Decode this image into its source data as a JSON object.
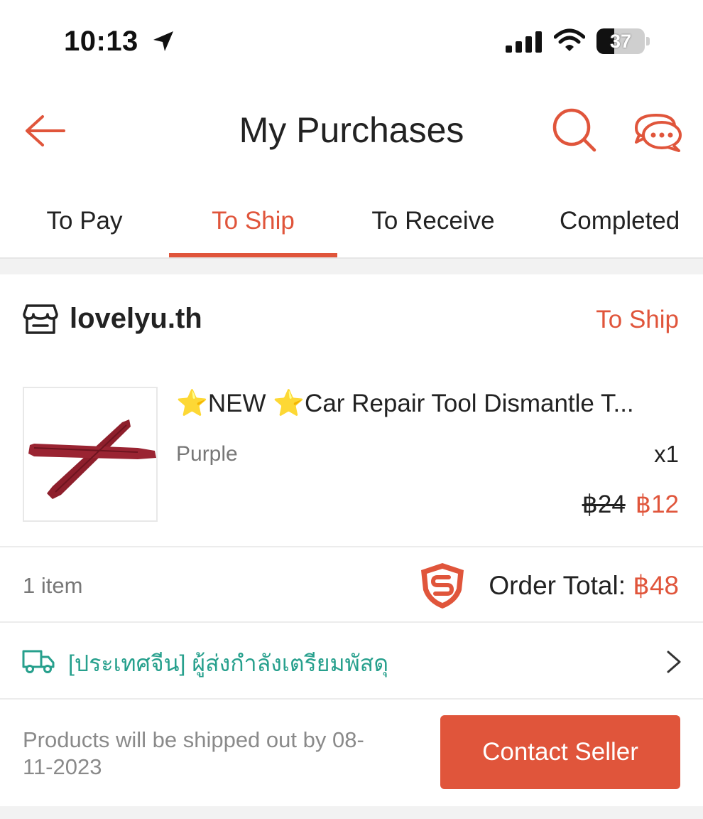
{
  "status_bar": {
    "time": "10:13",
    "battery_level": "37",
    "battery_fraction": 0.37
  },
  "header": {
    "title": "My Purchases"
  },
  "tabs": [
    {
      "label": "To Pay",
      "active": false
    },
    {
      "label": "To Ship",
      "active": true
    },
    {
      "label": "To Receive",
      "active": false
    },
    {
      "label": "Completed",
      "active": false
    }
  ],
  "order": {
    "shop_name": "lovelyu.th",
    "status": "To Ship",
    "product": {
      "star": "⭐",
      "name_part1": "NEW ",
      "name_part2": "Car Repair Tool Dismantle T...",
      "variant": "Purple",
      "quantity": "x1",
      "original_price": "฿24",
      "price": "฿12"
    },
    "item_count": "1 item",
    "order_total_label": "Order Total: ",
    "order_total": "฿48",
    "shipping_status": "[ประเทศจีน] ผู้ส่งกำลังเตรียมพัสดุ",
    "ship_note": "Products will be shipped out by 08-11-2023",
    "contact_button": "Contact Seller"
  },
  "colors": {
    "accent": "#e0553b",
    "shipping_green": "#27a08d",
    "product_red": "#8e1f2c"
  },
  "icons": {
    "back": "back-arrow-icon",
    "search": "search-icon",
    "chat": "chat-icon",
    "shop": "shop-icon",
    "shield": "shopee-guarantee-shield-icon",
    "truck": "truck-icon",
    "chevron": "chevron-right-icon"
  }
}
